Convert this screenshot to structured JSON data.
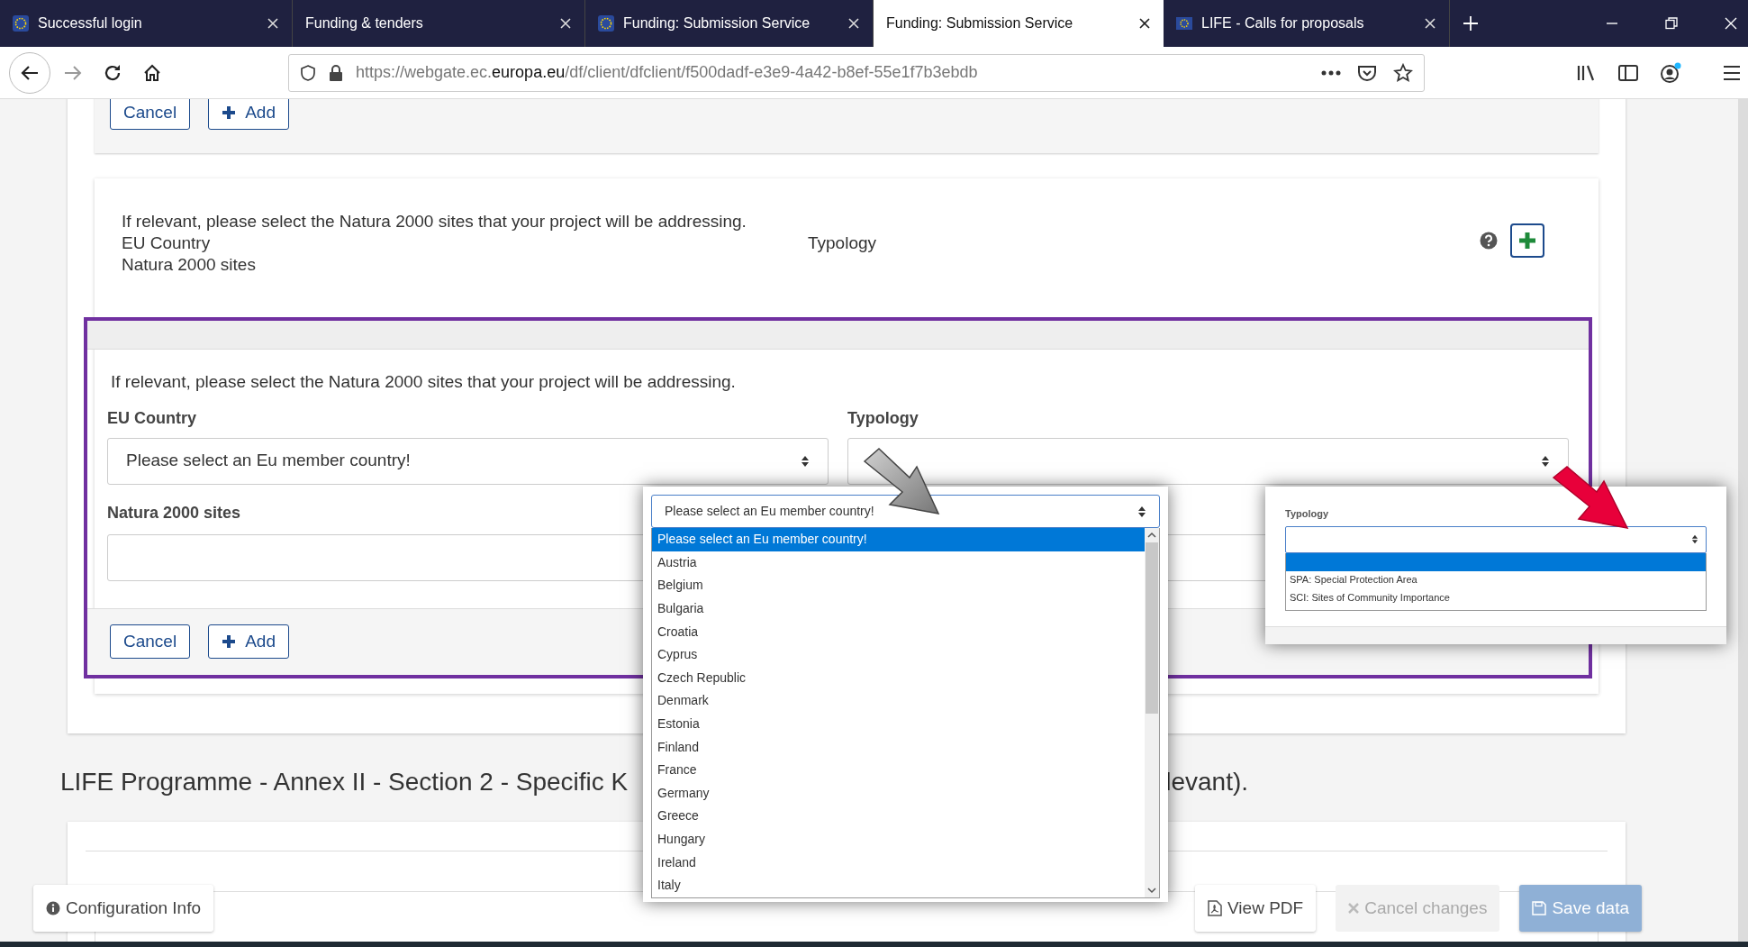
{
  "browser": {
    "tabs": [
      {
        "title": "Successful login",
        "selected": false
      },
      {
        "title": "Funding & tenders",
        "selected": false
      },
      {
        "title": "Funding: Submission Service",
        "selected": false
      },
      {
        "title": "Funding: Submission Service",
        "selected": true
      },
      {
        "title": "LIFE - Calls for proposals",
        "selected": false
      }
    ],
    "url": "https://webgate.ec.**europa.eu**/df/client/dfclient/f500dadf-e3e9-4a42-b8ef-55e1f7b3ebdb"
  },
  "previous_form": {
    "buttons": [
      {
        "label": "Cancel",
        "kind": "plain"
      },
      {
        "label": "Add",
        "kind": "add"
      }
    ]
  },
  "natura_summary": {
    "instruction": "If relevant, please select the Natura 2000 sites that your project will be addressing.",
    "country_label": "EU Country",
    "sites_label": "Natura 2000 sites",
    "typology_label": "Typology"
  },
  "natura_form": {
    "instruction": "If relevant, please select the Natura 2000 sites that your project will be addressing.",
    "country_label": "EU Country",
    "country_value": "Please select an Eu member country!",
    "typology_label": "Typology",
    "sites_label": "Natura 2000 sites",
    "buttons": [
      {
        "label": "Cancel",
        "kind": "plain"
      },
      {
        "label": "Add",
        "kind": "add"
      }
    ]
  },
  "section_heading": {
    "visible_start": "LIFE Programme - Annex II - Section 2 - Specific K",
    "visible_end": "levant)."
  },
  "country_dropdown": {
    "value": "Please select an Eu member country!",
    "options": [
      {
        "label": "Please select an Eu member country!",
        "selected": true
      },
      {
        "label": "Austria",
        "selected": false
      },
      {
        "label": "Belgium",
        "selected": false
      },
      {
        "label": "Bulgaria",
        "selected": false
      },
      {
        "label": "Croatia",
        "selected": false
      },
      {
        "label": "Cyprus",
        "selected": false
      },
      {
        "label": "Czech Republic",
        "selected": false
      },
      {
        "label": "Denmark",
        "selected": false
      },
      {
        "label": "Estonia",
        "selected": false
      },
      {
        "label": "Finland",
        "selected": false
      },
      {
        "label": "France",
        "selected": false
      },
      {
        "label": "Germany",
        "selected": false
      },
      {
        "label": "Greece",
        "selected": false
      },
      {
        "label": "Hungary",
        "selected": false
      },
      {
        "label": "Ireland",
        "selected": false
      },
      {
        "label": "Italy",
        "selected": false
      }
    ]
  },
  "typology_dropdown": {
    "label": "Typology",
    "options": [
      {
        "selected": true
      },
      {
        "label": "SPA: Special Protection Area",
        "selected": false
      },
      {
        "label": "SCI: Sites of Community Importance",
        "selected": false
      }
    ]
  },
  "footer": {
    "buttons": [
      {
        "label": "Configuration Info",
        "kind": "info",
        "disabled": false
      },
      {
        "label": "View PDF",
        "kind": "pdf",
        "disabled": false
      },
      {
        "label": "Cancel changes",
        "kind": "cancel",
        "disabled": true
      },
      {
        "label": "Save data",
        "kind": "save",
        "disabled": true
      }
    ]
  }
}
